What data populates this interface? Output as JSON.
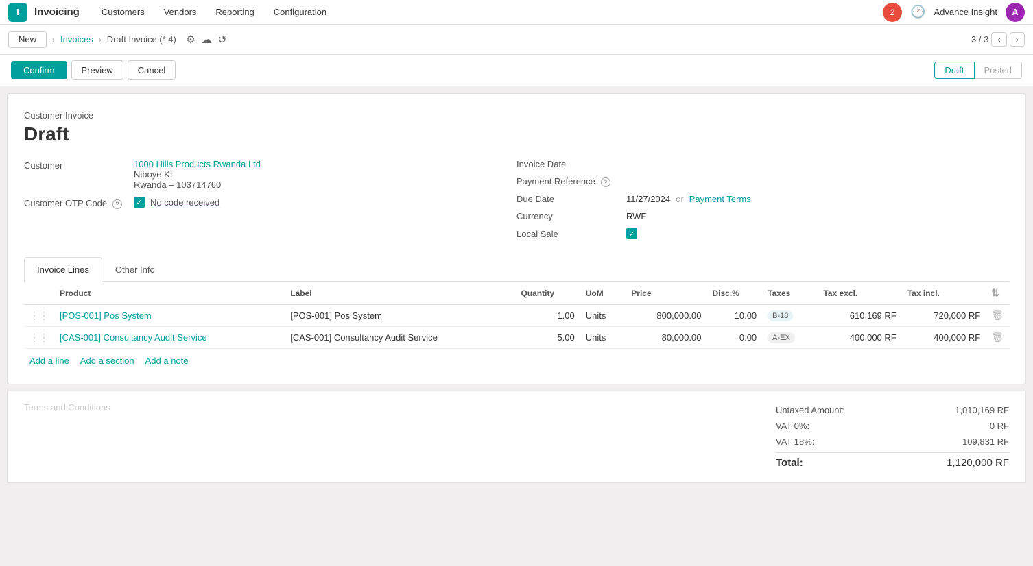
{
  "app": {
    "icon": "I",
    "title": "Invoicing"
  },
  "nav": {
    "items": [
      "Customers",
      "Vendors",
      "Reporting",
      "Configuration"
    ]
  },
  "topRight": {
    "notifications": "2",
    "advanceInsight": "Advance Insight",
    "userInitial": "A"
  },
  "breadcrumb": {
    "new_label": "New",
    "parent": "Invoices",
    "current": "Draft Invoice (* 4)",
    "counter": "3 / 3"
  },
  "actions": {
    "confirm": "Confirm",
    "preview": "Preview",
    "cancel": "Cancel"
  },
  "status": {
    "draft": "Draft",
    "posted": "Posted"
  },
  "invoice": {
    "type": "Customer Invoice",
    "state": "Draft"
  },
  "form": {
    "customer_label": "Customer",
    "customer_name": "1000 Hills Products Rwanda Ltd",
    "customer_line2": "Niboye KI",
    "customer_line3": "Rwanda – 103714760",
    "otp_label": "Customer OTP Code",
    "otp_question": "?",
    "otp_checkbox": "✓",
    "otp_text": "No code received",
    "invoice_date_label": "Invoice Date",
    "payment_ref_label": "Payment Reference",
    "payment_ref_question": "?",
    "due_date_label": "Due Date",
    "due_date_value": "11/27/2024",
    "or_text": "or",
    "payment_terms_text": "Payment Terms",
    "currency_label": "Currency",
    "currency_value": "RWF",
    "local_sale_label": "Local Sale",
    "local_sale_checked": "✓"
  },
  "tabs": [
    {
      "id": "invoice-lines",
      "label": "Invoice Lines"
    },
    {
      "id": "other-info",
      "label": "Other Info"
    }
  ],
  "table": {
    "headers": {
      "drag": "",
      "product": "Product",
      "label": "Label",
      "quantity": "Quantity",
      "uom": "UoM",
      "price": "Price",
      "disc": "Disc.%",
      "taxes": "Taxes",
      "tax_excl": "Tax excl.",
      "tax_incl": "Tax incl.",
      "actions": ""
    },
    "rows": [
      {
        "product_link": "[POS-001] Pos System",
        "label": "[POS-001] Pos System",
        "quantity": "1.00",
        "uom": "Units",
        "price": "800,000.00",
        "disc": "10.00",
        "tax_badge": "B-18",
        "tax_badge_type": "b18",
        "tax_excl": "610,169 RF",
        "tax_incl": "720,000 RF"
      },
      {
        "product_link": "[CAS-001] Consultancy Audit Service",
        "label": "[CAS-001] Consultancy Audit Service",
        "quantity": "5.00",
        "uom": "Units",
        "price": "80,000.00",
        "disc": "0.00",
        "tax_badge": "A-EX",
        "tax_badge_type": "aex",
        "tax_excl": "400,000 RF",
        "tax_incl": "400,000 RF"
      }
    ],
    "add_line": "Add a line",
    "add_section": "Add a section",
    "add_note": "Add a note"
  },
  "summary": {
    "terms_label": "Terms and Conditions",
    "untaxed_label": "Untaxed Amount:",
    "untaxed_value": "1,010,169 RF",
    "vat0_label": "VAT 0%:",
    "vat0_value": "0 RF",
    "vat18_label": "VAT 18%:",
    "vat18_value": "109,831 RF",
    "total_label": "Total:",
    "total_value": "1,120,000 RF"
  }
}
